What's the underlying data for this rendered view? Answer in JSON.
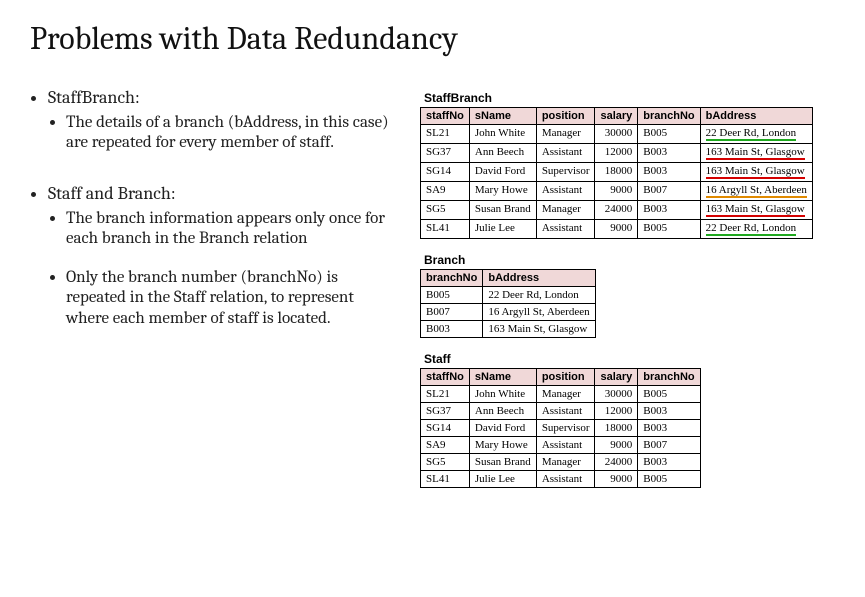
{
  "title": "Problems with Data Redundancy",
  "bullets": {
    "b1": "StaffBranch:",
    "b1_1": "The details of a branch (bAddress, in this case) are repeated for every member of staff.",
    "b2": "Staff and Branch:",
    "b2_1": "The branch information appears only once for each branch in the Branch relation",
    "b2_2": "Only the branch number (branchNo) is repeated in the Staff relation, to represent where each member of staff is located."
  },
  "tables": {
    "staffBranch": {
      "title": "StaffBranch",
      "headers": [
        "staffNo",
        "sName",
        "position",
        "salary",
        "branchNo",
        "bAddress"
      ],
      "rows": [
        {
          "staffNo": "SL21",
          "sName": "John White",
          "position": "Manager",
          "salary": "30000",
          "branchNo": "B005",
          "bAddress": "22 Deer Rd, London",
          "ul": "green"
        },
        {
          "staffNo": "SG37",
          "sName": "Ann Beech",
          "position": "Assistant",
          "salary": "12000",
          "branchNo": "B003",
          "bAddress": "163 Main St, Glasgow",
          "ul": "red"
        },
        {
          "staffNo": "SG14",
          "sName": "David Ford",
          "position": "Supervisor",
          "salary": "18000",
          "branchNo": "B003",
          "bAddress": "163 Main St, Glasgow",
          "ul": "red"
        },
        {
          "staffNo": "SA9",
          "sName": "Mary Howe",
          "position": "Assistant",
          "salary": "9000",
          "branchNo": "B007",
          "bAddress": "16 Argyll St, Aberdeen",
          "ul": "orange"
        },
        {
          "staffNo": "SG5",
          "sName": "Susan Brand",
          "position": "Manager",
          "salary": "24000",
          "branchNo": "B003",
          "bAddress": "163 Main St, Glasgow",
          "ul": "red"
        },
        {
          "staffNo": "SL41",
          "sName": "Julie Lee",
          "position": "Assistant",
          "salary": "9000",
          "branchNo": "B005",
          "bAddress": "22 Deer Rd, London",
          "ul": "green"
        }
      ]
    },
    "branch": {
      "title": "Branch",
      "headers": [
        "branchNo",
        "bAddress"
      ],
      "rows": [
        {
          "branchNo": "B005",
          "bAddress": "22 Deer Rd, London"
        },
        {
          "branchNo": "B007",
          "bAddress": "16 Argyll St, Aberdeen"
        },
        {
          "branchNo": "B003",
          "bAddress": "163 Main St, Glasgow"
        }
      ]
    },
    "staff": {
      "title": "Staff",
      "headers": [
        "staffNo",
        "sName",
        "position",
        "salary",
        "branchNo"
      ],
      "rows": [
        {
          "staffNo": "SL21",
          "sName": "John White",
          "position": "Manager",
          "salary": "30000",
          "branchNo": "B005"
        },
        {
          "staffNo": "SG37",
          "sName": "Ann Beech",
          "position": "Assistant",
          "salary": "12000",
          "branchNo": "B003"
        },
        {
          "staffNo": "SG14",
          "sName": "David Ford",
          "position": "Supervisor",
          "salary": "18000",
          "branchNo": "B003"
        },
        {
          "staffNo": "SA9",
          "sName": "Mary Howe",
          "position": "Assistant",
          "salary": "9000",
          "branchNo": "B007"
        },
        {
          "staffNo": "SG5",
          "sName": "Susan Brand",
          "position": "Manager",
          "salary": "24000",
          "branchNo": "B003"
        },
        {
          "staffNo": "SL41",
          "sName": "Julie Lee",
          "position": "Assistant",
          "salary": "9000",
          "branchNo": "B005"
        }
      ]
    }
  }
}
